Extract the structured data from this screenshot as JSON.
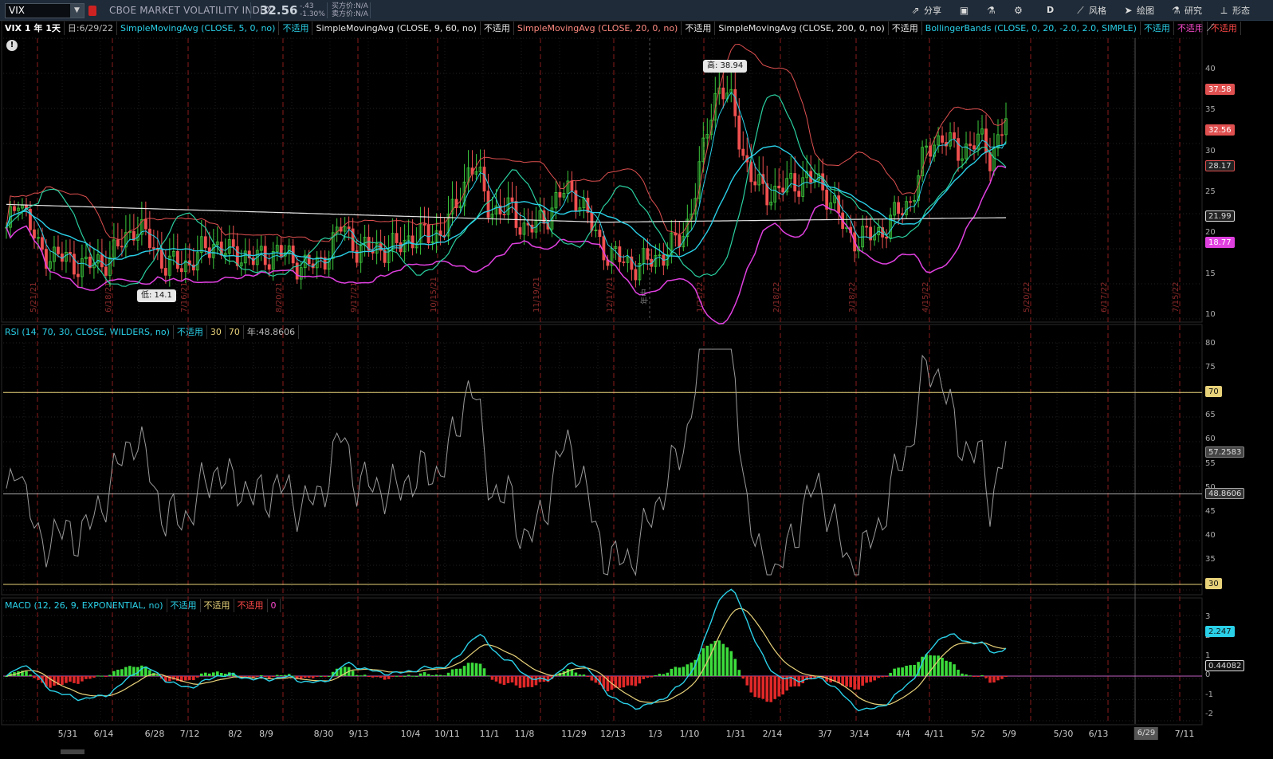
{
  "topbar": {
    "symbol": "VIX",
    "name": "CBOE MARKET VOLATILITY INDEX",
    "price": "32.56",
    "change": "-.43",
    "change_pct": "-1.30%",
    "bid": "买方价:N/A",
    "ask": "卖方价:N/A",
    "buttons": [
      {
        "label": "分享",
        "icon": "share-icon"
      },
      {
        "label": "",
        "icon": "calendar-icon"
      },
      {
        "label": "",
        "icon": "flask-icon"
      },
      {
        "label": "",
        "icon": "gear-icon"
      },
      {
        "label": "D",
        "icon": ""
      },
      {
        "label": "风格",
        "icon": "style-icon"
      },
      {
        "label": "绘图",
        "icon": "cursor-icon"
      },
      {
        "label": "研究",
        "icon": "beaker-icon"
      },
      {
        "label": "形态",
        "icon": "pattern-icon"
      }
    ]
  },
  "price_pane": {
    "header": {
      "main": "VIX 1 年 1天",
      "date": "日:6/29/22",
      "studies": [
        {
          "label": "SimpleMovingAvg (CLOSE, 5, 0, no)",
          "value": "不适用"
        },
        {
          "label": "SimpleMovingAvg (CLOSE, 9, 60, no)",
          "value": "不适用"
        },
        {
          "label": "SimpleMovingAvg (CLOSE, 20, 0, no)",
          "value": "不适用"
        },
        {
          "label": "SimpleMovingAvg (CLOSE, 200, 0, no)",
          "value": "不适用"
        },
        {
          "label": "BollingerBands (CLOSE, 0, 20, -2.0, 2.0, SIMPLE)",
          "value": "不适用",
          "value2": "不适用",
          "value3": "不适用"
        }
      ]
    },
    "y_ticks": [
      "40",
      "35",
      "30",
      "25",
      "20",
      "15",
      "10"
    ],
    "tags": [
      "37.58",
      "32.56",
      "28.17",
      "21.99",
      "18.77"
    ],
    "high_label": "高: 38.94",
    "low_label": "低: 14.1",
    "vline_labels": [
      "5/21/21",
      "6/18/21",
      "7/16/21",
      "8/20/21",
      "9/17/21",
      "10/15/21",
      "11/19/21",
      "12/17/21",
      "1/21/22",
      "2/18/22",
      "3/18/22",
      "4/15/22",
      "5/20/22",
      "6/17/22",
      "7/15/22"
    ],
    "year_marker": "年中"
  },
  "rsi_pane": {
    "header": {
      "label": "RSI (14, 70, 30, CLOSE, WILDERS, no)",
      "value": "不适用",
      "ob": "30",
      "os": "70",
      "year": "年:48.8606"
    },
    "y_ticks": [
      "80",
      "75",
      "70",
      "65",
      "60",
      "55",
      "50",
      "45",
      "40",
      "35",
      "30"
    ],
    "tags": [
      "70",
      "57.2583",
      "48.8606",
      "30"
    ]
  },
  "macd_pane": {
    "header": {
      "label": "MACD (12, 26, 9, EXPONENTIAL, no)",
      "value": "不适用",
      "value2": "不适用",
      "value3": "不适用",
      "zero": "0"
    },
    "y_ticks": [
      "3",
      "2",
      "1",
      "0",
      "-1",
      "-2"
    ],
    "tags": [
      "2.247",
      "0.44082"
    ]
  },
  "date_axis": {
    "labels": [
      "5/31",
      "6/14",
      "6/28",
      "7/12",
      "8/2",
      "8/9",
      "8/30",
      "9/13",
      "10/4",
      "10/11",
      "11/1",
      "11/8",
      "11/29",
      "12/13",
      "1/3",
      "1/10",
      "1/31",
      "2/14",
      "3/7",
      "3/14",
      "4/4",
      "4/11",
      "5/2",
      "5/9",
      "5/30",
      "6/13",
      "7/11"
    ],
    "current": "6/29"
  },
  "colors": {
    "up": "#3cc83c",
    "down": "#f05050",
    "sma5": "#2ad0e8",
    "sma9": "#2ad0a0",
    "sma20": "#f05a5a",
    "sma200": "#e8e8e8",
    "bb_lower": "#e040e0",
    "rsi": "#9a9a9a",
    "macd": "#2ad0e8",
    "signal": "#e8d27a"
  }
}
